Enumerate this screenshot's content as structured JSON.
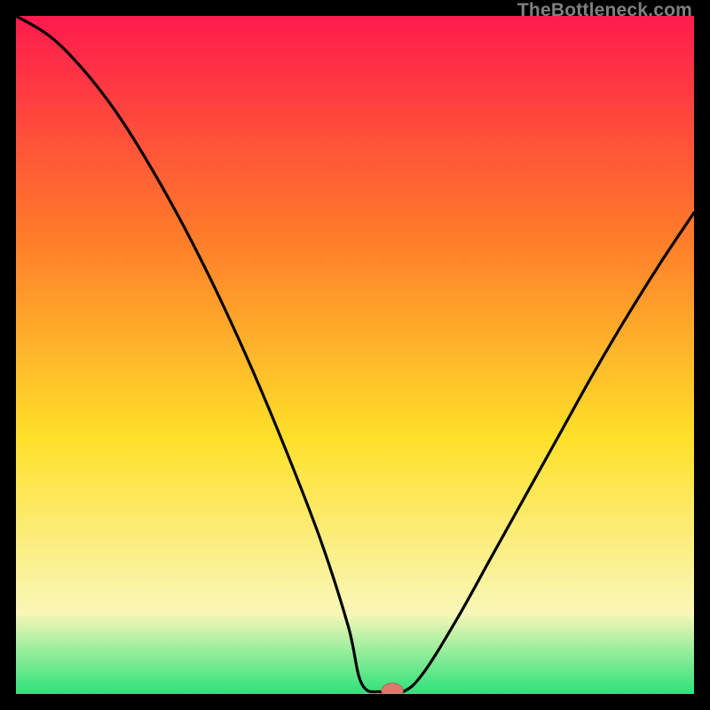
{
  "watermark": "TheBottleneck.com",
  "colors": {
    "frame": "#000000",
    "gradient_top": "#ff1a4e",
    "gradient_upper": "#ff7a2a",
    "gradient_mid": "#ffe029",
    "gradient_lower": "#f9f7b8",
    "gradient_bottom": "#2be27a",
    "curve": "#000000",
    "marker_fill": "#d97c6d",
    "marker_stroke": "#b96354"
  },
  "chart_data": {
    "type": "line",
    "title": "",
    "xlabel": "",
    "ylabel": "",
    "xlim": [
      0,
      100
    ],
    "ylim": [
      0,
      100
    ],
    "notes": "V-shaped bottleneck curve on a vertical red→orange→yellow→pale→green gradient. Minimum sits near x≈54. Left branch steeper than right branch. Small rounded marker at the trough.",
    "series": [
      {
        "name": "bottleneck-curve",
        "x": [
          0,
          5,
          10,
          15,
          20,
          25,
          30,
          35,
          40,
          45,
          49,
          51,
          54,
          57,
          60,
          65,
          70,
          75,
          80,
          85,
          90,
          95,
          100
        ],
        "values": [
          100,
          97,
          92,
          85.5,
          77.5,
          68.5,
          58.5,
          47.5,
          35.5,
          22.5,
          10,
          1.5,
          0.3,
          0.3,
          3,
          11,
          20,
          29,
          38,
          47,
          55.5,
          63.5,
          71
        ]
      }
    ],
    "marker": {
      "x": 55.5,
      "y": 0.5,
      "rx": 1.6,
      "ry": 1.1
    }
  }
}
